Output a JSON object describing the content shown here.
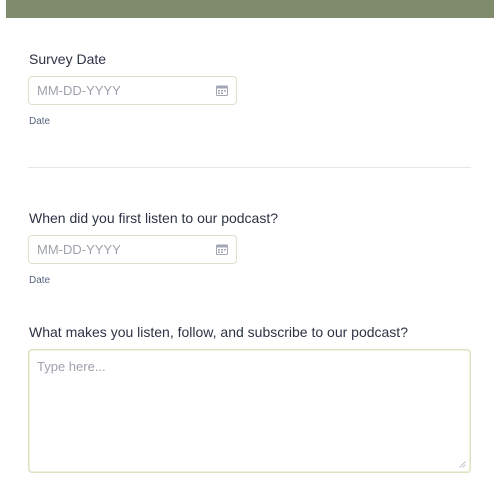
{
  "form": {
    "header_color": "#7f8b6c",
    "fields": [
      {
        "label": "Survey Date",
        "placeholder": "MM-DD-YYYY",
        "sublabel": "Date",
        "icon": "calendar-icon"
      },
      {
        "label": "When did you first listen to our podcast?",
        "placeholder": "MM-DD-YYYY",
        "sublabel": "Date",
        "icon": "calendar-icon"
      },
      {
        "label": "What makes you listen, follow, and subscribe to our podcast?",
        "placeholder": "Type here...",
        "icon": "resize-handle-icon"
      }
    ]
  }
}
